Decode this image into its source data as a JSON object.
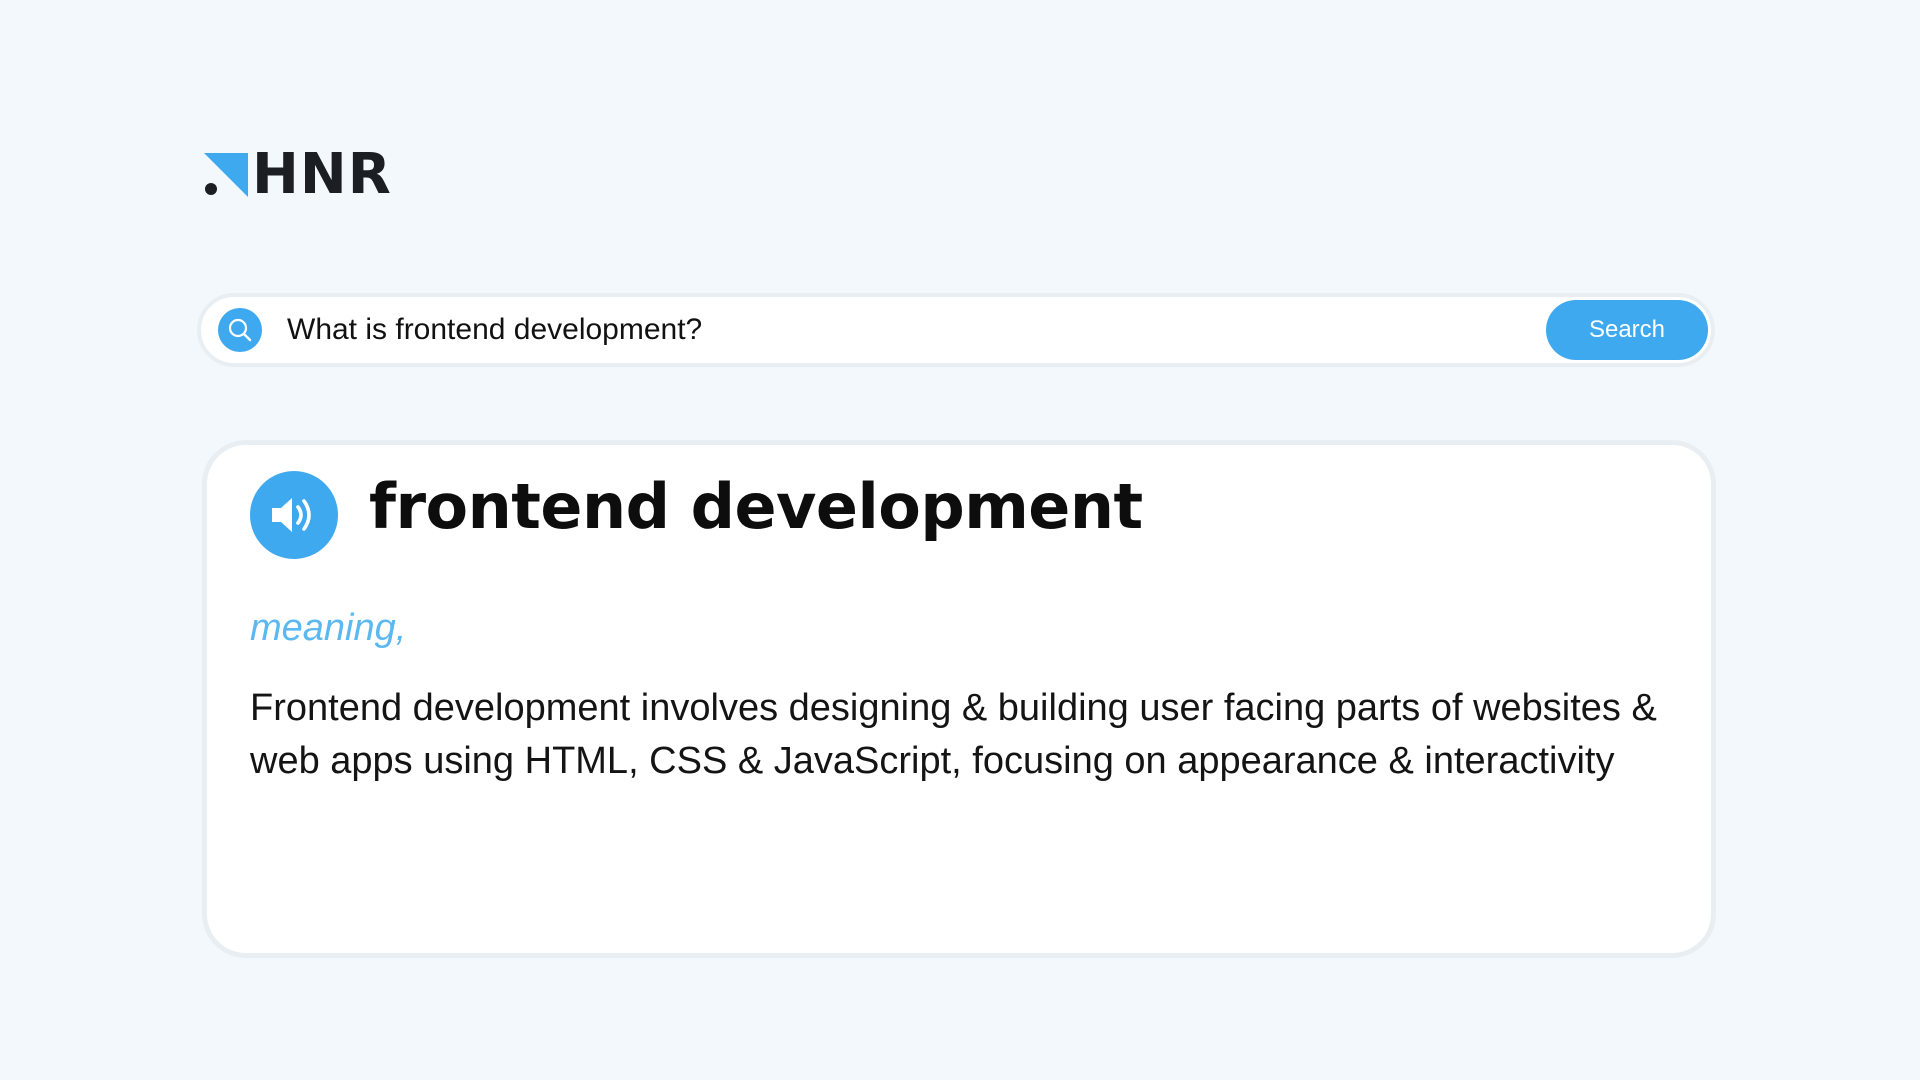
{
  "logo": {
    "text": "HNR",
    "icon": "hnr-logo-mark",
    "accent_color": "#3fa9f0"
  },
  "search": {
    "value": "What is frontend development?",
    "placeholder": "",
    "button_label": "Search",
    "icon": "search-icon"
  },
  "result": {
    "term": "frontend development",
    "audio_icon": "speaker-icon",
    "meaning_label": "meaning,",
    "definition": "Frontend development involves designing & building user facing parts of websites & web apps using HTML, CSS & JavaScript, focusing on appearance & interactivity"
  },
  "colors": {
    "accent": "#3fa9f0",
    "meaning_label": "#5cb8f0",
    "background": "#f2f8fc",
    "card_border": "#e9eef2"
  }
}
